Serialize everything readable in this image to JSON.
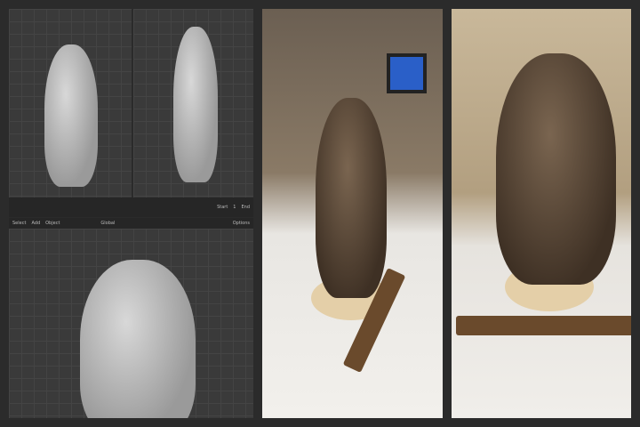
{
  "blender": {
    "menu": [
      "Select",
      "Add",
      "Object"
    ],
    "orientation": "Global",
    "timeline": {
      "start_label": "Start",
      "start_value": "1",
      "end_label": "End"
    },
    "options_label": "Options"
  }
}
